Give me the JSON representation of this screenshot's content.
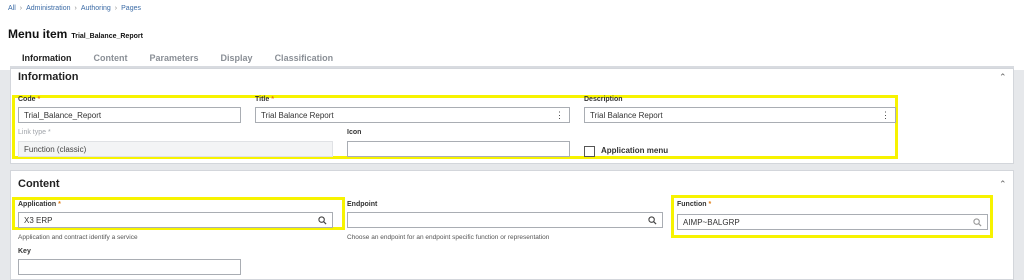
{
  "breadcrumb": [
    "All",
    "Administration",
    "Authoring",
    "Pages"
  ],
  "page": {
    "title": "Menu item",
    "subtitle": "Trial_Balance_Report"
  },
  "tabs": [
    "Information",
    "Content",
    "Parameters",
    "Display",
    "Classification"
  ],
  "information": {
    "title": "Information",
    "code": {
      "label": "Code",
      "value": "Trial_Balance_Report"
    },
    "title_field": {
      "label": "Title",
      "value": "Trial Balance Report"
    },
    "description": {
      "label": "Description",
      "value": "Trial Balance Report"
    },
    "link_type": {
      "label": "Link type",
      "value": "Function (classic)"
    },
    "icon": {
      "label": "Icon",
      "value": ""
    },
    "app_menu": {
      "label": "Application menu"
    }
  },
  "content": {
    "title": "Content",
    "application": {
      "label": "Application",
      "value": "X3 ERP",
      "hint": "Application and contract identify a service"
    },
    "endpoint": {
      "label": "Endpoint",
      "value": "",
      "hint": "Choose an endpoint for an endpoint specific function or representation"
    },
    "function": {
      "label": "Function",
      "value": "AIMP~BALGRP"
    },
    "key": {
      "label": "Key",
      "value": ""
    }
  },
  "colors": {
    "highlight": "#f7f300",
    "accent": "#1b6fc4",
    "required": "#e07a10"
  },
  "icons": [
    "chevron-right-icon",
    "chevron-up-icon",
    "kebab-icon",
    "search-icon",
    "asterisk-icon"
  ]
}
